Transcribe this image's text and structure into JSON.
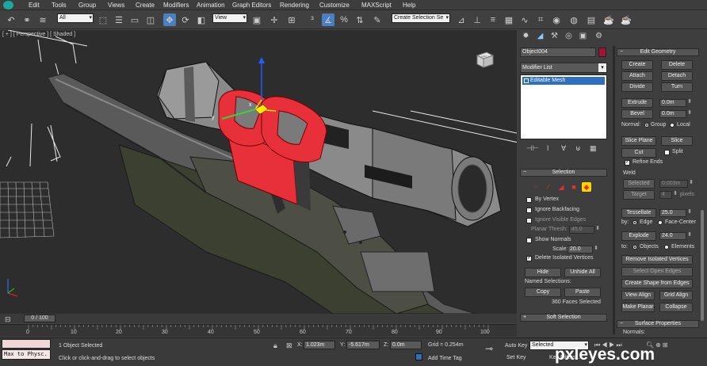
{
  "menubar": {
    "items": [
      "Edit",
      "Tools",
      "Group",
      "Views",
      "Create",
      "Modifiers",
      "Animation",
      "Graph Editors",
      "Rendering",
      "Customize",
      "MAXScript",
      "Help"
    ]
  },
  "toolbar": {
    "selection_filter": "All",
    "ref_coord": "View",
    "named_selection": "Create Selection Se"
  },
  "viewport": {
    "label": "[ + ] [ Perspective ] [ Shaded ]",
    "gizmo_axes": {
      "x": "x",
      "y": "y"
    },
    "viewcube_label": "LEFT"
  },
  "command_panel": {
    "object_name": "Object004",
    "modifier_list": "Modifier List",
    "stack_item": "Editable Mesh",
    "selection": {
      "title": "Selection",
      "by_vertex": "By Vertex",
      "ignore_backfacing": "Ignore Backfacing",
      "ignore_visible_edges": "Ignore Visible Edges",
      "planar_thresh_label": "Planar Thresh:",
      "planar_thresh_value": "45.0",
      "show_normals": "Show Normals",
      "scale_label": "Scale:",
      "scale_value": "20.0",
      "delete_isolated": "Delete Isolated Vertices",
      "hide": "Hide",
      "unhide_all": "Unhide All",
      "named_selections": "Named Selections:",
      "copy": "Copy",
      "paste": "Paste",
      "status": "360 Faces Selected"
    },
    "soft_selection": {
      "title": "Soft Selection"
    },
    "edit_geometry": {
      "title": "Edit Geometry",
      "create": "Create",
      "delete": "Delete",
      "attach": "Attach",
      "detach": "Detach",
      "divide": "Divide",
      "turn": "Turn",
      "extrude": "Extrude",
      "extrude_value": "0.0m",
      "bevel": "Bevel",
      "bevel_value": "0.0m",
      "normal_label": "Normal:",
      "group": "Group",
      "local": "Local",
      "slice_plane": "Slice Plane",
      "slice": "Slice",
      "cut": "Cut",
      "split": "Split",
      "refine_ends": "Refine Ends",
      "weld": "Weld",
      "selected": "Selected",
      "selected_value": "0.003m",
      "target": "Target",
      "target_value": "4",
      "pixels": "pixels",
      "tessellate": "Tessellate",
      "tessellate_value": "25.0",
      "by_label": "by:",
      "edge": "Edge",
      "face_center": "Face-Center",
      "explode": "Explode",
      "explode_value": "24.0",
      "to_label": "to:",
      "objects": "Objects",
      "elements": "Elements",
      "remove_isolated": "Remove Isolated Vertices",
      "select_open_edges": "Select Open Edges",
      "create_shape": "Create Shape from Edges",
      "view_align": "View Align",
      "grid_align": "Grid Align",
      "make_planar": "Make Planar",
      "collapse": "Collapse"
    },
    "surface_properties": {
      "title": "Surface Properties",
      "normals": "Normals:"
    }
  },
  "timeline": {
    "slider": "0 / 100",
    "ticks": [
      "0",
      "10",
      "20",
      "30",
      "40",
      "50",
      "60",
      "70",
      "80",
      "90",
      "100"
    ]
  },
  "status": {
    "maxscript": "Max to Physc.",
    "selected": "1 Object Selected",
    "prompt": "Click or click-and-drag to select objects",
    "x_label": "X:",
    "x_value": "1.023m",
    "y_label": "Y:",
    "y_value": "-5.617m",
    "z_label": "Z:",
    "z_value": "0.0m",
    "grid": "Grid = 0.254m",
    "auto_key": "Auto Key",
    "set_key": "Set Key",
    "selected_dropdown": "Selected",
    "key_filters": "Key Filters...",
    "add_time_tag": "Add Time Tag"
  },
  "watermark": "pxleyes.com",
  "colors": {
    "selection_red": "#e8303a",
    "accent_blue": "#2f6fbf",
    "object_color": "#a0143a"
  }
}
